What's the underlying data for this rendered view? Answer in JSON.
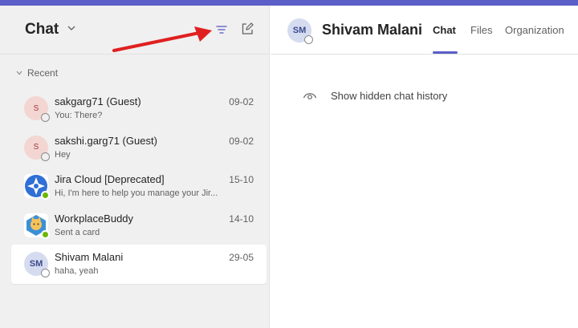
{
  "sidebar": {
    "title": "Chat",
    "recent_label": "Recent",
    "chats": [
      {
        "name": "sakgarg71 (Guest)",
        "preview": "You: There?",
        "date": "09-02",
        "initials": "S"
      },
      {
        "name": "sakshi.garg71 (Guest)",
        "preview": "Hey",
        "date": "09-02",
        "initials": "S"
      },
      {
        "name": "Jira Cloud [Deprecated]",
        "preview": "Hi, I'm here to help you manage your Jir...",
        "date": "15-10"
      },
      {
        "name": "WorkplaceBuddy",
        "preview": "Sent a card",
        "date": "14-10"
      },
      {
        "name": "Shivam Malani",
        "preview": "haha, yeah",
        "date": "29-05",
        "initials": "SM"
      }
    ]
  },
  "header": {
    "avatar_initials": "SM",
    "title": "Shivam Malani",
    "tabs": [
      "Chat",
      "Files",
      "Organization"
    ]
  },
  "main": {
    "hidden_history_label": "Show hidden chat history"
  },
  "colors": {
    "accent": "#5b5fc7",
    "annotation_arrow": "#e02020",
    "presence_available": "#6bb700"
  }
}
